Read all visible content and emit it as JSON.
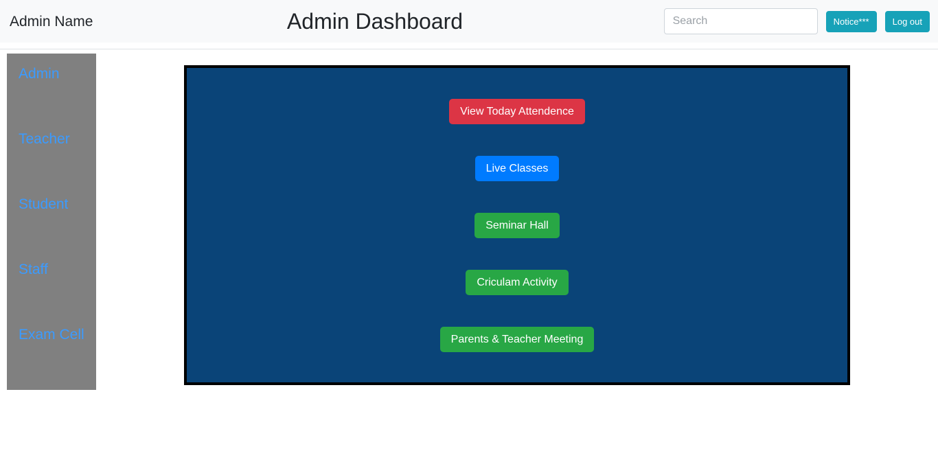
{
  "header": {
    "brand": "Admin Name",
    "title": "Admin Dashboard",
    "search": {
      "placeholder": "Search",
      "value": ""
    },
    "notice_label": "Notice***",
    "logout_label": "Log out",
    "background_color": "#f8f9fa",
    "button_color": "#17a2b8"
  },
  "sidebar": {
    "background_color": "#808080",
    "link_color": "#3b9bff",
    "items": [
      {
        "label": "Admin"
      },
      {
        "label": "Teacher"
      },
      {
        "label": "Student"
      },
      {
        "label": "Staff"
      },
      {
        "label": "Exam Cell"
      }
    ]
  },
  "main": {
    "panel_background_color": "#0a4478",
    "panel_border_color": "#000000",
    "buttons": [
      {
        "label": "View Today Attendence",
        "color": "#dc3545",
        "style": "btn-danger"
      },
      {
        "label": "Live Classes",
        "color": "#007bff",
        "style": "btn-primary"
      },
      {
        "label": "Seminar Hall",
        "color": "#28a745",
        "style": "btn-success"
      },
      {
        "label": "Criculam Activity",
        "color": "#28a745",
        "style": "btn-success"
      },
      {
        "label": "Parents & Teacher Meeting",
        "color": "#28a745",
        "style": "btn-success"
      }
    ]
  }
}
